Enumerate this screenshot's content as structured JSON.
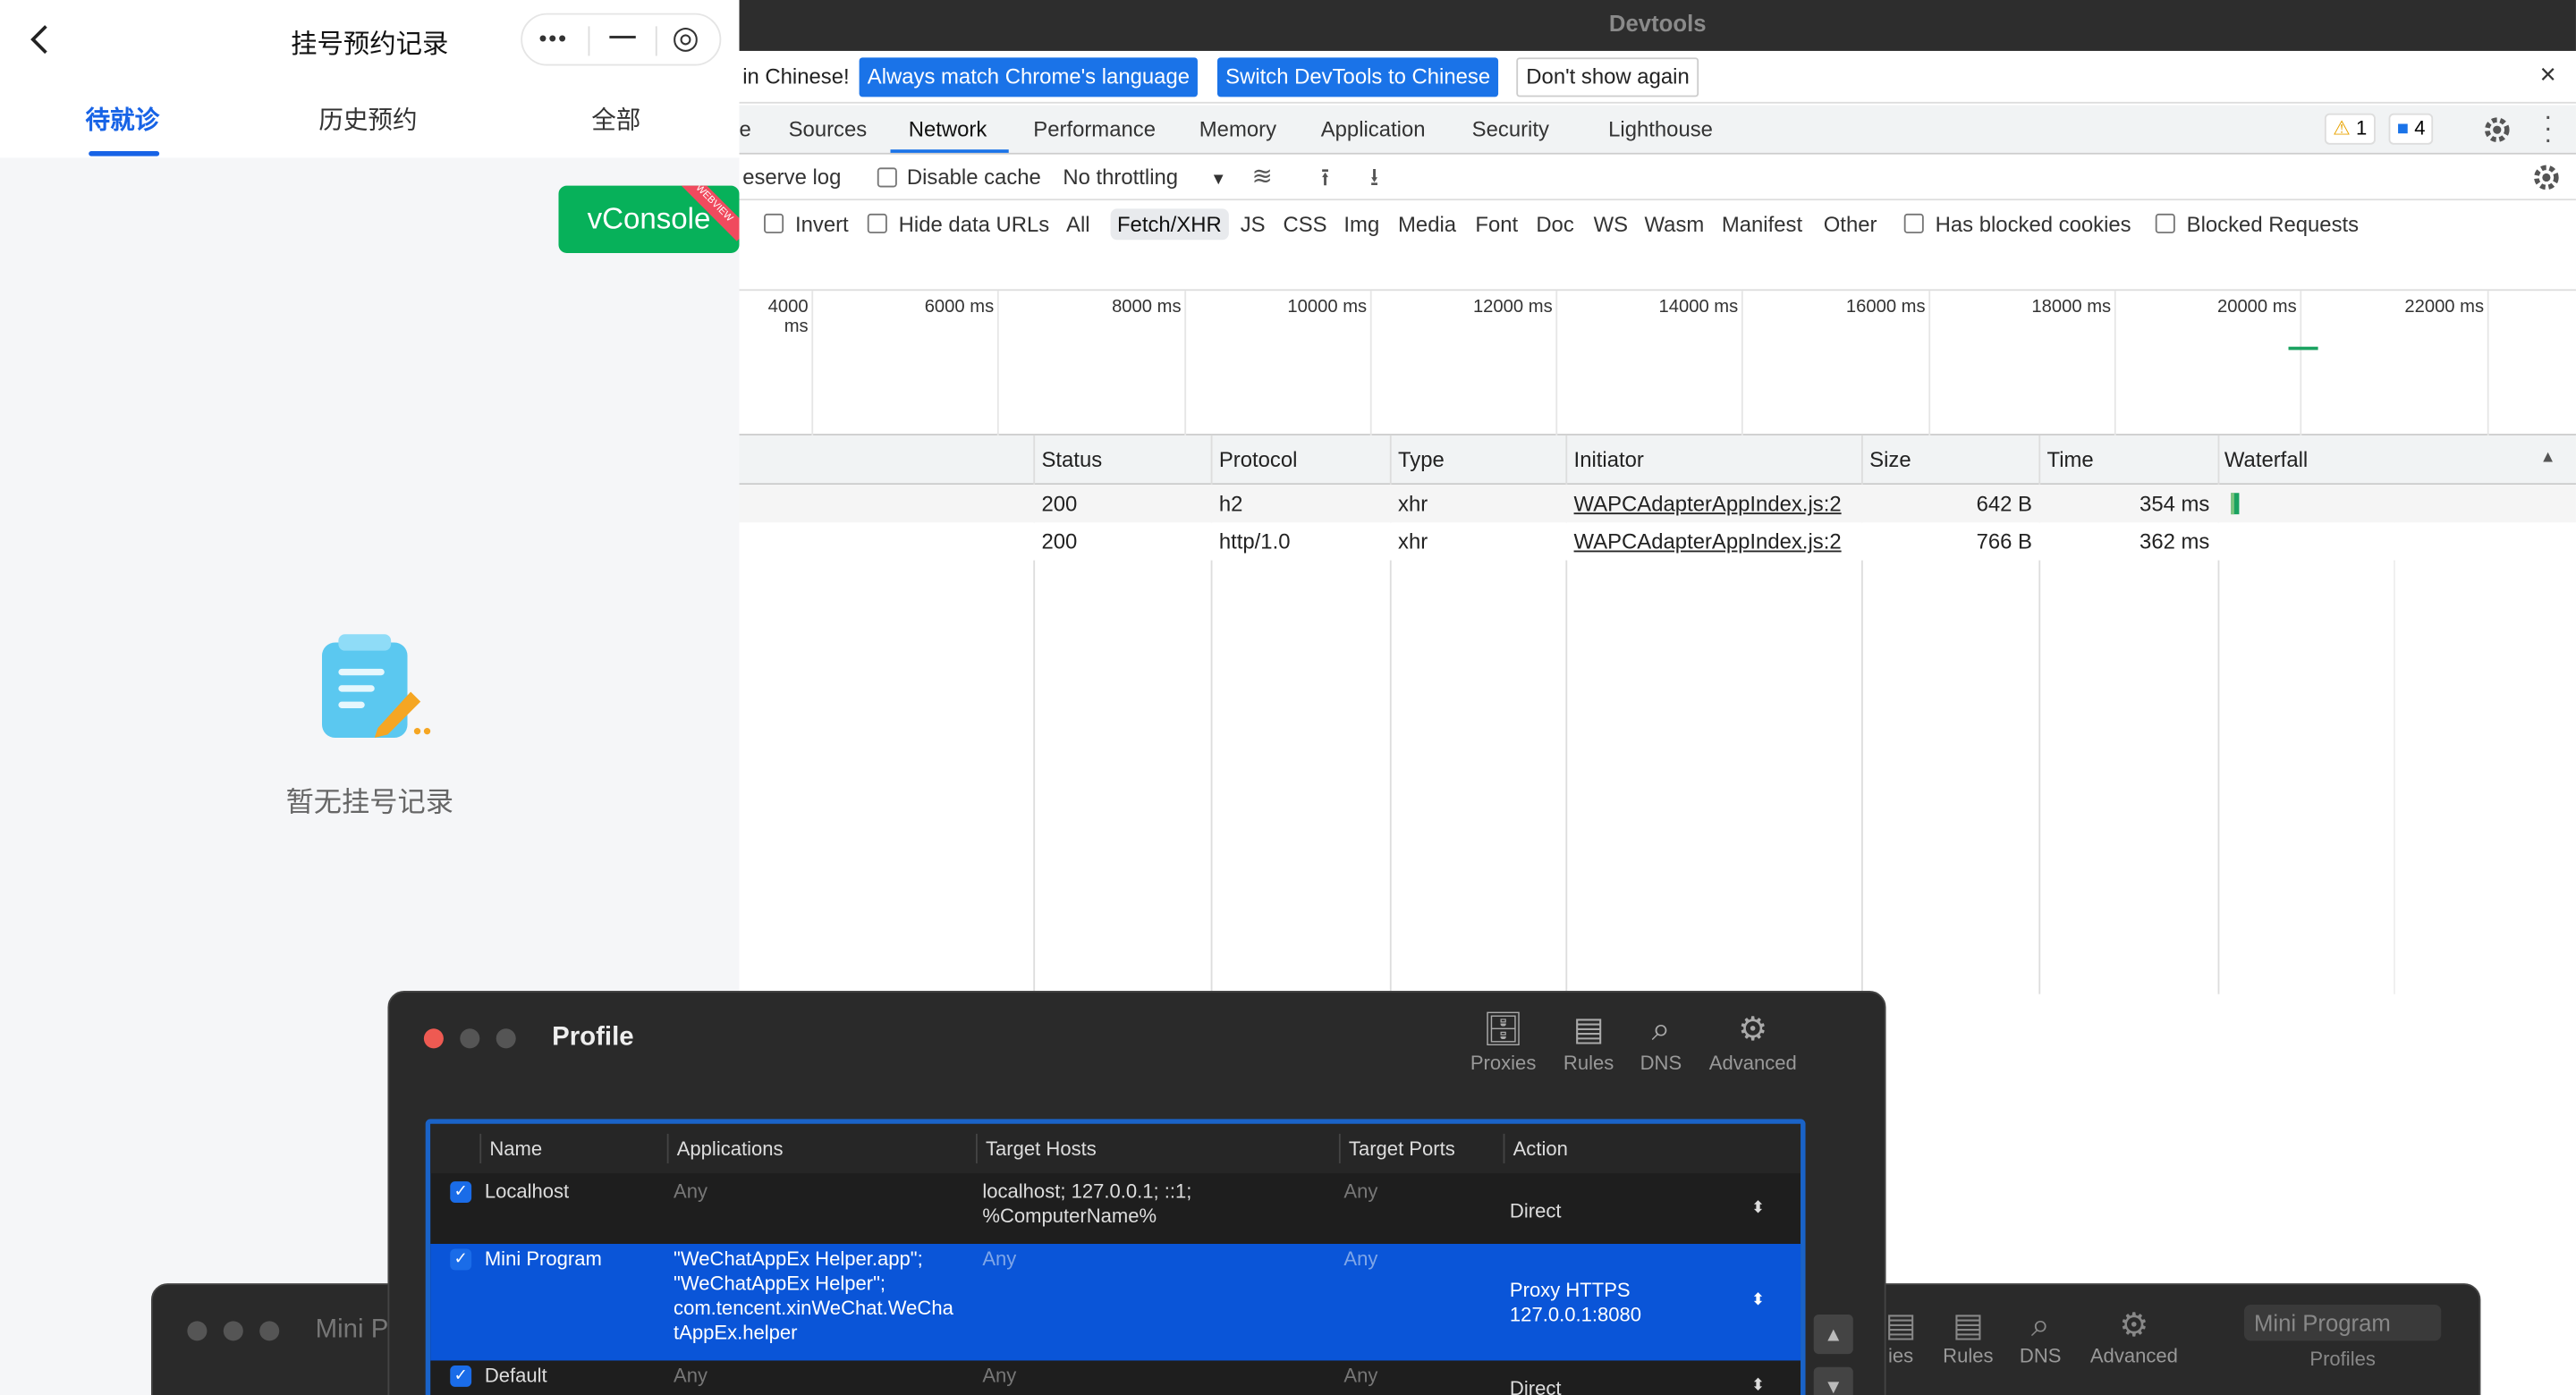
{
  "mini_program": {
    "title": "挂号预约记录",
    "capsule": {
      "more": "•••",
      "minimize": "—",
      "close": "◎"
    },
    "tabs": [
      "待就诊",
      "历史预约",
      "全部"
    ],
    "active_tab": 0,
    "vconsole": {
      "label": "vConsole",
      "ribbon": "WEBVIEW"
    },
    "empty_text": "暂无挂号记录"
  },
  "devtools": {
    "window_title": "Devtools",
    "infobar": {
      "message": "in Chinese!",
      "btn_match": "Always match Chrome's language",
      "btn_switch": "Switch DevTools to Chinese",
      "btn_dismiss": "Don't show again",
      "close": "×"
    },
    "panel_tabs": [
      "e",
      "Sources",
      "Network",
      "Performance",
      "Memory",
      "Application",
      "Security",
      "Lighthouse"
    ],
    "active_panel": "Network",
    "warnings": "1",
    "messages": "4",
    "toolbar": {
      "preserve_log": "eserve log",
      "disable_cache": "Disable cache",
      "throttling": "No throttling"
    },
    "filters": {
      "invert": "Invert",
      "hide_data_urls": "Hide data URLs",
      "types": [
        "All",
        "Fetch/XHR",
        "JS",
        "CSS",
        "Img",
        "Media",
        "Font",
        "Doc",
        "WS",
        "Wasm",
        "Manifest",
        "Other"
      ],
      "active_type": "Fetch/XHR",
      "has_blocked_cookies": "Has blocked cookies",
      "blocked_requests": "Blocked Requests"
    },
    "timeline_ticks": [
      "4000 ms",
      "6000 ms",
      "8000 ms",
      "10000 ms",
      "12000 ms",
      "14000 ms",
      "16000 ms",
      "18000 ms",
      "20000 ms",
      "22000 ms"
    ],
    "columns": {
      "status": "Status",
      "protocol": "Protocol",
      "type": "Type",
      "initiator": "Initiator",
      "size": "Size",
      "time": "Time",
      "waterfall": "Waterfall",
      "sort_arrow": "▲"
    },
    "requests": [
      {
        "status": "200",
        "protocol": "h2",
        "type": "xhr",
        "initiator": "WAPCAdapterAppIndex.js:2",
        "size": "642 B",
        "time": "354 ms"
      },
      {
        "status": "200",
        "protocol": "http/1.0",
        "type": "xhr",
        "initiator": "WAPCAdapterAppIndex.js:2",
        "size": "766 B",
        "time": "362 ms"
      }
    ]
  },
  "proxy_profile": {
    "title": "Profile",
    "toolbar": [
      {
        "icon": "proxies-icon",
        "label": "Proxies"
      },
      {
        "icon": "rules-icon",
        "label": "Rules"
      },
      {
        "icon": "dns-icon",
        "label": "DNS"
      },
      {
        "icon": "advanced-icon",
        "label": "Advanced"
      }
    ],
    "headers": {
      "name": "Name",
      "applications": "Applications",
      "target_hosts": "Target Hosts",
      "target_ports": "Target Ports",
      "action": "Action"
    },
    "rules": [
      {
        "checked": true,
        "name": "Localhost",
        "applications": "Any",
        "target_hosts": "localhost; 127.0.0.1; ::1;\n%ComputerName%",
        "target_ports": "Any",
        "action": "Direct"
      },
      {
        "checked": true,
        "name": "Mini Program",
        "applications": "\"WeChatAppEx Helper.app\";\n\"WeChatAppEx Helper\";\ncom.tencent.xinWeChat.WeCha\ntAppEx.helper",
        "target_hosts": "Any",
        "target_ports": "Any",
        "action": "Proxy HTTPS\n127.0.0.1:8080"
      },
      {
        "checked": true,
        "name": "Default",
        "applications": "Any",
        "target_hosts": "Any",
        "target_ports": "Any",
        "action": "Direct"
      }
    ]
  },
  "back_window": {
    "title": "Mini P",
    "icons": [
      {
        "icon": "rules-icon",
        "label": "ies"
      },
      {
        "icon": "rules-icon",
        "label": "Rules"
      },
      {
        "icon": "dns-icon",
        "label": "DNS"
      },
      {
        "icon": "advanced-icon",
        "label": "Advanced"
      }
    ],
    "profile_value": "Mini Program",
    "profile_label": "Profiles"
  }
}
